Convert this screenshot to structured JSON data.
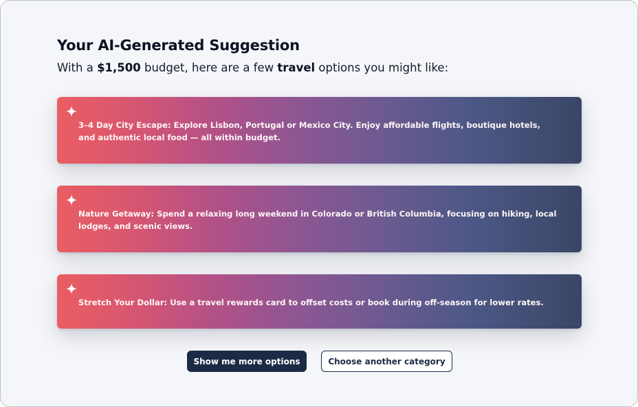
{
  "header": {
    "title": "Your AI-Generated Suggestion",
    "subtitle_prefix": "With a ",
    "budget": "$1,500",
    "subtitle_middle": " budget, here are a few ",
    "category": "travel",
    "subtitle_suffix": " options you might like:"
  },
  "suggestions": [
    {
      "icon": "sparkle-icon",
      "text": "3–4 Day City Escape: Explore Lisbon, Portugal or Mexico City. Enjoy affordable flights, boutique hotels, and authentic local food — all within budget."
    },
    {
      "icon": "sparkle-icon",
      "text": "Nature Getaway: Spend a relaxing long weekend in Colorado or British Columbia, focusing on hiking, local lodges, and scenic views."
    },
    {
      "icon": "sparkle-icon",
      "text": "Stretch Your Dollar: Use a travel rewards card to offset costs or book during off-season for lower rates."
    }
  ],
  "actions": {
    "more_label": "Show me more options",
    "category_label": "Choose another category"
  },
  "colors": {
    "background": "#f5f6f9",
    "gradient_start": "#ea5e62",
    "gradient_mid": "#8d5693",
    "gradient_end": "#3a4666",
    "primary_button": "#1c2b45",
    "text_dark": "#0c1324"
  }
}
